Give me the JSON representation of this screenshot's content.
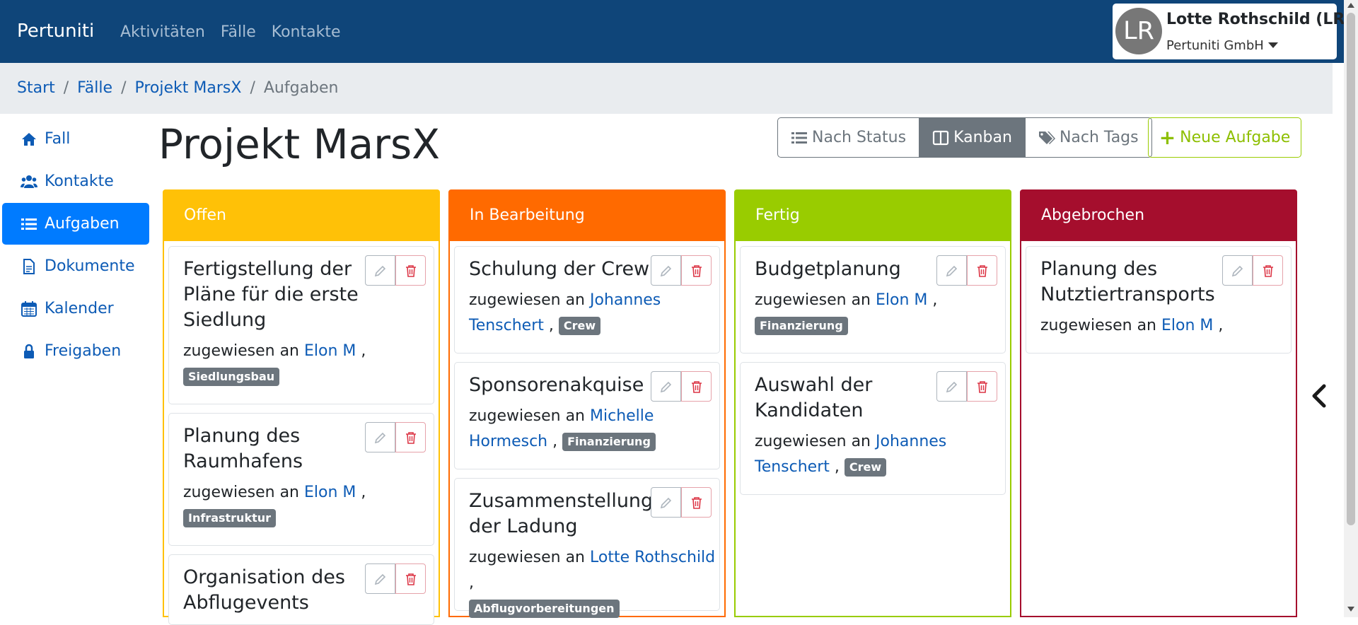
{
  "navbar": {
    "brand": "Pertuniti",
    "links": [
      "Aktivitäten",
      "Fälle",
      "Kontakte"
    ],
    "user": {
      "initials": "LR",
      "name": "Lotte Rothschild (LR)",
      "org": "Pertuniti GmbH"
    }
  },
  "breadcrumb": {
    "items": [
      "Start",
      "Fälle",
      "Projekt MarsX"
    ],
    "current": "Aufgaben",
    "separator": "/"
  },
  "sidebar": {
    "items": [
      {
        "label": "Fall",
        "icon": "home-icon"
      },
      {
        "label": "Kontakte",
        "icon": "users-icon"
      },
      {
        "label": "Aufgaben",
        "icon": "list-icon"
      },
      {
        "label": "Dokumente",
        "icon": "document-icon"
      },
      {
        "label": "Kalender",
        "icon": "calendar-icon"
      },
      {
        "label": "Freigaben",
        "icon": "lock-icon"
      }
    ]
  },
  "page": {
    "title": "Projekt MarsX"
  },
  "toolbar": {
    "view_status": "Nach Status",
    "view_kanban": "Kanban",
    "view_tags": "Nach Tags",
    "new_task": "Neue Aufgabe",
    "new_task_plus": "+"
  },
  "colors": {
    "navbar": "#0f4579",
    "offen": "#ffc107",
    "in_bearbeitung": "#ff6a00",
    "fertig": "#99cc00",
    "abgebrochen": "#a50e2d",
    "link": "#0d5bb5",
    "active": "#007bff"
  },
  "assign_prefix": "zugewiesen an",
  "columns": [
    {
      "title": "Offen",
      "cards": [
        {
          "title": "Fertigstellung der Pläne für die erste Siedlung",
          "assignee": "Elon M",
          "tag": "Siedlungsbau"
        },
        {
          "title": "Planung des Raumhafens",
          "assignee": "Elon M",
          "tag": "Infrastruktur"
        },
        {
          "title": "Organisation des Abflugevents",
          "assignee": "",
          "tag": ""
        }
      ]
    },
    {
      "title": "In Bearbeitung",
      "cards": [
        {
          "title": "Schulung der Crew",
          "assignee": "Johannes Tenschert",
          "tag": "Crew"
        },
        {
          "title": "Sponsorenakquise",
          "assignee": "Michelle Hormesch",
          "tag": "Finanzierung"
        },
        {
          "title": "Zusammenstellung der Ladung",
          "assignee": "Lotte Rothschild",
          "tag": "Abflugvorbereitungen"
        }
      ]
    },
    {
      "title": "Fertig",
      "cards": [
        {
          "title": "Budgetplanung",
          "assignee": "Elon M",
          "tag": "Finanzierung"
        },
        {
          "title": "Auswahl der Kandidaten",
          "assignee": "Johannes Tenschert",
          "tag": "Crew"
        }
      ]
    },
    {
      "title": "Abgebrochen",
      "cards": [
        {
          "title": "Planung des Nutztiertransports",
          "assignee": "Elon M",
          "tag": ""
        }
      ]
    }
  ]
}
